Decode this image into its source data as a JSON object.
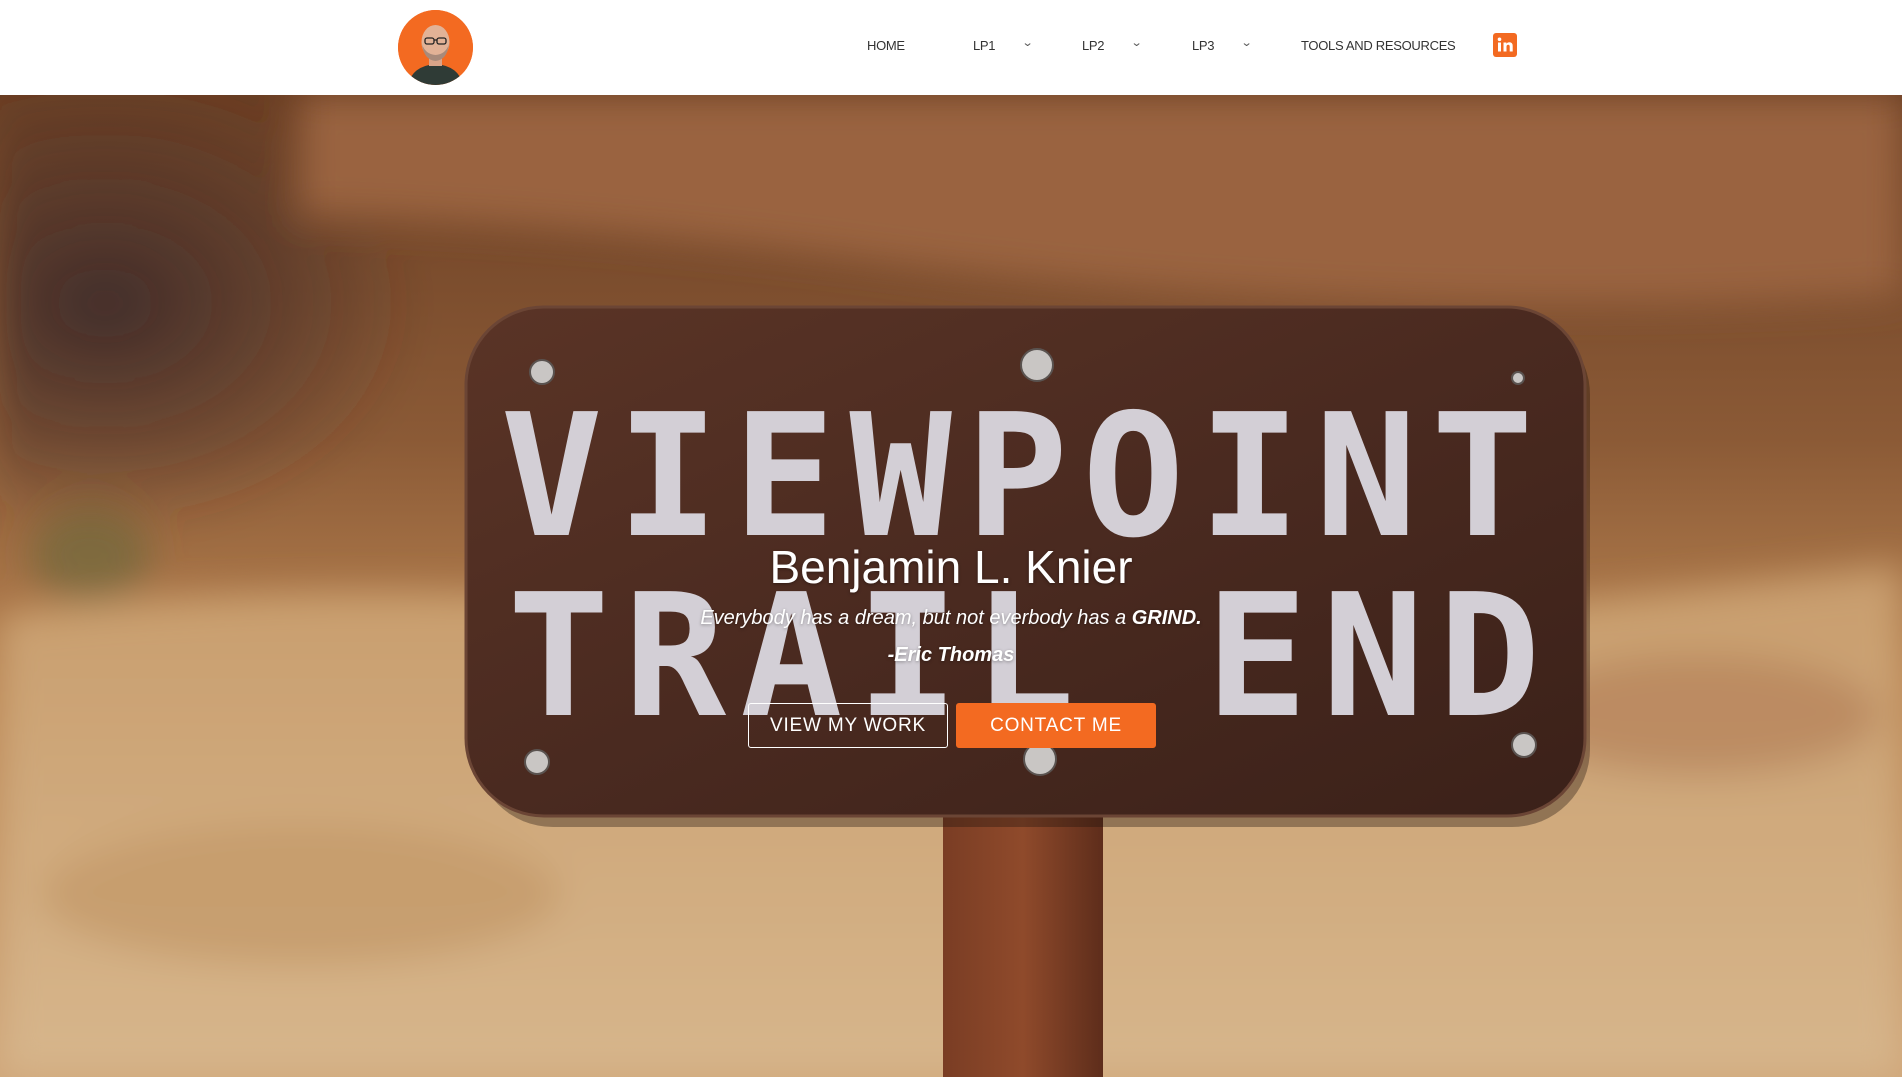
{
  "brand": {
    "accent_color": "#f36a21",
    "logo_icon": "profile-photo-avatar"
  },
  "nav": {
    "items": [
      {
        "label": "HOME",
        "has_dropdown": false
      },
      {
        "label": "LP1",
        "has_dropdown": true
      },
      {
        "label": "LP2",
        "has_dropdown": true
      },
      {
        "label": "LP3",
        "has_dropdown": true
      },
      {
        "label": "TOOLS AND RESOURCES",
        "has_dropdown": false
      }
    ],
    "dropdown_icon": "chevron-down-icon",
    "social_icon": "linkedin-icon",
    "linkedin_glyph": "in"
  },
  "hero": {
    "background": "trail-sign-photo",
    "sign_line1": "VIEWPOINT",
    "sign_line2": "TRAIL END",
    "title": "Benjamin L. Knier",
    "quote_prefix": "Everybody has a dream, but not everbody has a ",
    "quote_emphasis": "GRIND.",
    "quote_author": "-Eric Thomas",
    "primary_button": "VIEW MY WORK",
    "secondary_button": "CONTACT ME"
  }
}
